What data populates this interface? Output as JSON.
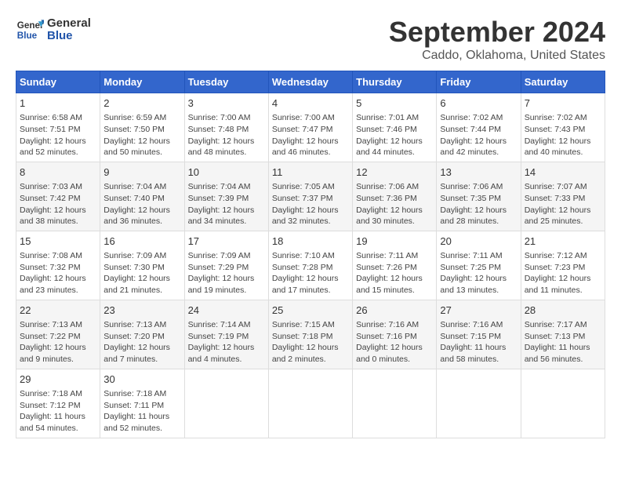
{
  "header": {
    "logo_line1": "General",
    "logo_line2": "Blue",
    "title": "September 2024",
    "subtitle": "Caddo, Oklahoma, United States"
  },
  "days_of_week": [
    "Sunday",
    "Monday",
    "Tuesday",
    "Wednesday",
    "Thursday",
    "Friday",
    "Saturday"
  ],
  "weeks": [
    [
      {
        "day": "1",
        "content": "Sunrise: 6:58 AM\nSunset: 7:51 PM\nDaylight: 12 hours\nand 52 minutes."
      },
      {
        "day": "2",
        "content": "Sunrise: 6:59 AM\nSunset: 7:50 PM\nDaylight: 12 hours\nand 50 minutes."
      },
      {
        "day": "3",
        "content": "Sunrise: 7:00 AM\nSunset: 7:48 PM\nDaylight: 12 hours\nand 48 minutes."
      },
      {
        "day": "4",
        "content": "Sunrise: 7:00 AM\nSunset: 7:47 PM\nDaylight: 12 hours\nand 46 minutes."
      },
      {
        "day": "5",
        "content": "Sunrise: 7:01 AM\nSunset: 7:46 PM\nDaylight: 12 hours\nand 44 minutes."
      },
      {
        "day": "6",
        "content": "Sunrise: 7:02 AM\nSunset: 7:44 PM\nDaylight: 12 hours\nand 42 minutes."
      },
      {
        "day": "7",
        "content": "Sunrise: 7:02 AM\nSunset: 7:43 PM\nDaylight: 12 hours\nand 40 minutes."
      }
    ],
    [
      {
        "day": "8",
        "content": "Sunrise: 7:03 AM\nSunset: 7:42 PM\nDaylight: 12 hours\nand 38 minutes."
      },
      {
        "day": "9",
        "content": "Sunrise: 7:04 AM\nSunset: 7:40 PM\nDaylight: 12 hours\nand 36 minutes."
      },
      {
        "day": "10",
        "content": "Sunrise: 7:04 AM\nSunset: 7:39 PM\nDaylight: 12 hours\nand 34 minutes."
      },
      {
        "day": "11",
        "content": "Sunrise: 7:05 AM\nSunset: 7:37 PM\nDaylight: 12 hours\nand 32 minutes."
      },
      {
        "day": "12",
        "content": "Sunrise: 7:06 AM\nSunset: 7:36 PM\nDaylight: 12 hours\nand 30 minutes."
      },
      {
        "day": "13",
        "content": "Sunrise: 7:06 AM\nSunset: 7:35 PM\nDaylight: 12 hours\nand 28 minutes."
      },
      {
        "day": "14",
        "content": "Sunrise: 7:07 AM\nSunset: 7:33 PM\nDaylight: 12 hours\nand 25 minutes."
      }
    ],
    [
      {
        "day": "15",
        "content": "Sunrise: 7:08 AM\nSunset: 7:32 PM\nDaylight: 12 hours\nand 23 minutes."
      },
      {
        "day": "16",
        "content": "Sunrise: 7:09 AM\nSunset: 7:30 PM\nDaylight: 12 hours\nand 21 minutes."
      },
      {
        "day": "17",
        "content": "Sunrise: 7:09 AM\nSunset: 7:29 PM\nDaylight: 12 hours\nand 19 minutes."
      },
      {
        "day": "18",
        "content": "Sunrise: 7:10 AM\nSunset: 7:28 PM\nDaylight: 12 hours\nand 17 minutes."
      },
      {
        "day": "19",
        "content": "Sunrise: 7:11 AM\nSunset: 7:26 PM\nDaylight: 12 hours\nand 15 minutes."
      },
      {
        "day": "20",
        "content": "Sunrise: 7:11 AM\nSunset: 7:25 PM\nDaylight: 12 hours\nand 13 minutes."
      },
      {
        "day": "21",
        "content": "Sunrise: 7:12 AM\nSunset: 7:23 PM\nDaylight: 12 hours\nand 11 minutes."
      }
    ],
    [
      {
        "day": "22",
        "content": "Sunrise: 7:13 AM\nSunset: 7:22 PM\nDaylight: 12 hours\nand 9 minutes."
      },
      {
        "day": "23",
        "content": "Sunrise: 7:13 AM\nSunset: 7:20 PM\nDaylight: 12 hours\nand 7 minutes."
      },
      {
        "day": "24",
        "content": "Sunrise: 7:14 AM\nSunset: 7:19 PM\nDaylight: 12 hours\nand 4 minutes."
      },
      {
        "day": "25",
        "content": "Sunrise: 7:15 AM\nSunset: 7:18 PM\nDaylight: 12 hours\nand 2 minutes."
      },
      {
        "day": "26",
        "content": "Sunrise: 7:16 AM\nSunset: 7:16 PM\nDaylight: 12 hours\nand 0 minutes."
      },
      {
        "day": "27",
        "content": "Sunrise: 7:16 AM\nSunset: 7:15 PM\nDaylight: 11 hours\nand 58 minutes."
      },
      {
        "day": "28",
        "content": "Sunrise: 7:17 AM\nSunset: 7:13 PM\nDaylight: 11 hours\nand 56 minutes."
      }
    ],
    [
      {
        "day": "29",
        "content": "Sunrise: 7:18 AM\nSunset: 7:12 PM\nDaylight: 11 hours\nand 54 minutes."
      },
      {
        "day": "30",
        "content": "Sunrise: 7:18 AM\nSunset: 7:11 PM\nDaylight: 11 hours\nand 52 minutes."
      },
      {
        "day": "",
        "content": ""
      },
      {
        "day": "",
        "content": ""
      },
      {
        "day": "",
        "content": ""
      },
      {
        "day": "",
        "content": ""
      },
      {
        "day": "",
        "content": ""
      }
    ]
  ]
}
